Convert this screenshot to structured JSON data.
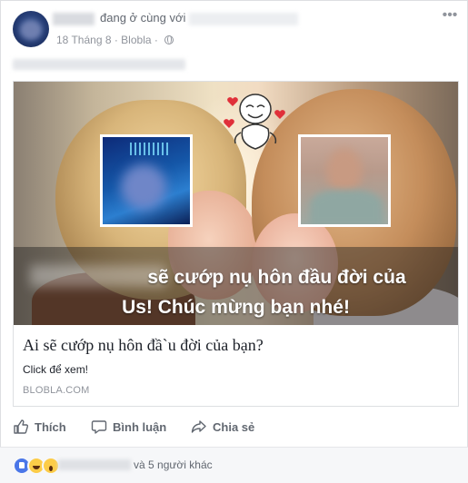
{
  "post": {
    "with_text": "đang ở cùng với",
    "date": "18 Tháng 8",
    "separator": " · ",
    "app": "Blobla",
    "sep2": " · "
  },
  "preview": {
    "overlay_line1": "sẽ cướp nụ hôn đầu đời của",
    "overlay_line2": "Us! Chúc mừng bạn nhé!",
    "title": "Ai sẽ cướp nụ hôn đầ`u đời của bạn?",
    "description": "Click để xem!",
    "domain": "BLOBLA.COM"
  },
  "actions": {
    "like": "Thích",
    "comment": "Bình luận",
    "share": "Chia sẻ"
  },
  "reactions": {
    "summary": "và 5 người khác",
    "types": [
      "like-icon",
      "haha-icon",
      "wow-icon"
    ]
  },
  "colors": {
    "accent": "#4a76e8",
    "text_secondary": "#616770",
    "meta": "#90949c"
  }
}
